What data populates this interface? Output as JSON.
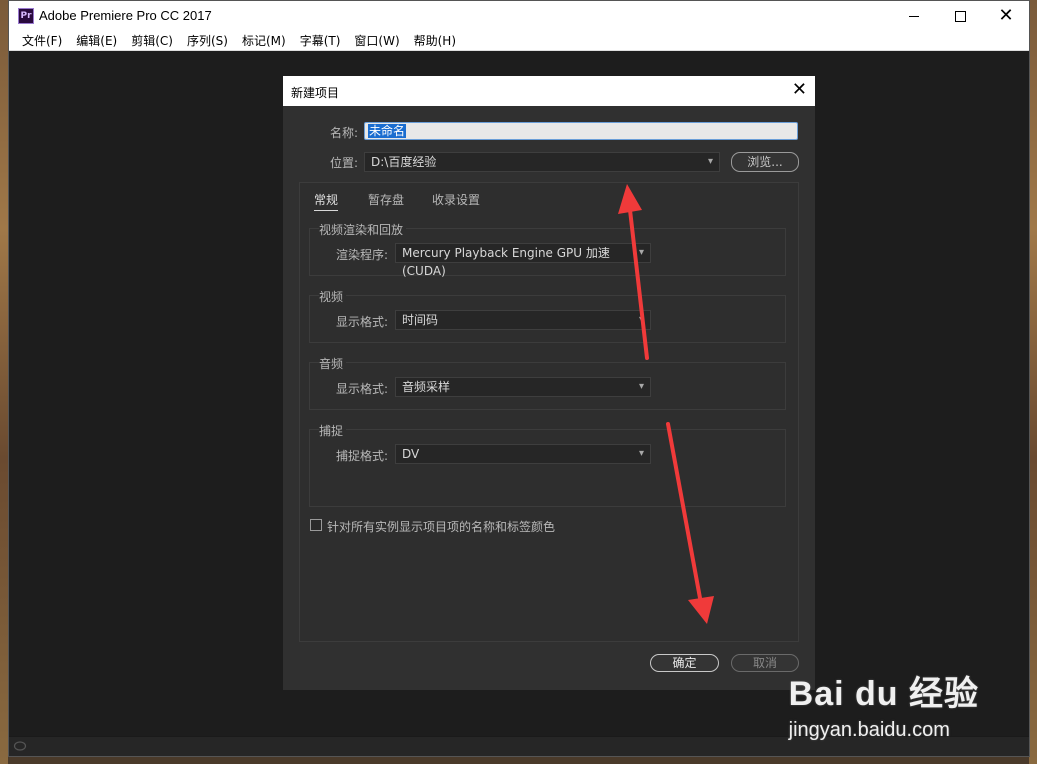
{
  "app": {
    "title": "Adobe Premiere Pro CC 2017",
    "icon_text": "Pr"
  },
  "menu": [
    "文件(F)",
    "编辑(E)",
    "剪辑(C)",
    "序列(S)",
    "标记(M)",
    "字幕(T)",
    "窗口(W)",
    "帮助(H)"
  ],
  "dialog": {
    "title": "新建项目",
    "name_label": "名称:",
    "name_value": "未命名",
    "location_label": "位置:",
    "location_value": "D:\\百度经验",
    "browse_label": "浏览...",
    "tabs": [
      "常规",
      "暂存盘",
      "收录设置"
    ],
    "active_tab": 0,
    "groups": {
      "video_render": {
        "title": "视频渲染和回放",
        "label": "渲染程序:",
        "value": "Mercury Playback Engine GPU 加速 (CUDA)"
      },
      "video": {
        "title": "视频",
        "label": "显示格式:",
        "value": "时间码"
      },
      "audio": {
        "title": "音频",
        "label": "显示格式:",
        "value": "音频采样"
      },
      "capture": {
        "title": "捕捉",
        "label": "捕捉格式:",
        "value": "DV"
      }
    },
    "checkbox_label": "针对所有实例显示项目项的名称和标签颜色",
    "checkbox_checked": false,
    "ok_label": "确定",
    "cancel_label": "取消"
  },
  "watermark": {
    "brand": "Bai du 经验",
    "url": "jingyan.baidu.com"
  },
  "colors": {
    "annotation_arrow": "#f03a3a",
    "selection": "#1a6dd0"
  }
}
